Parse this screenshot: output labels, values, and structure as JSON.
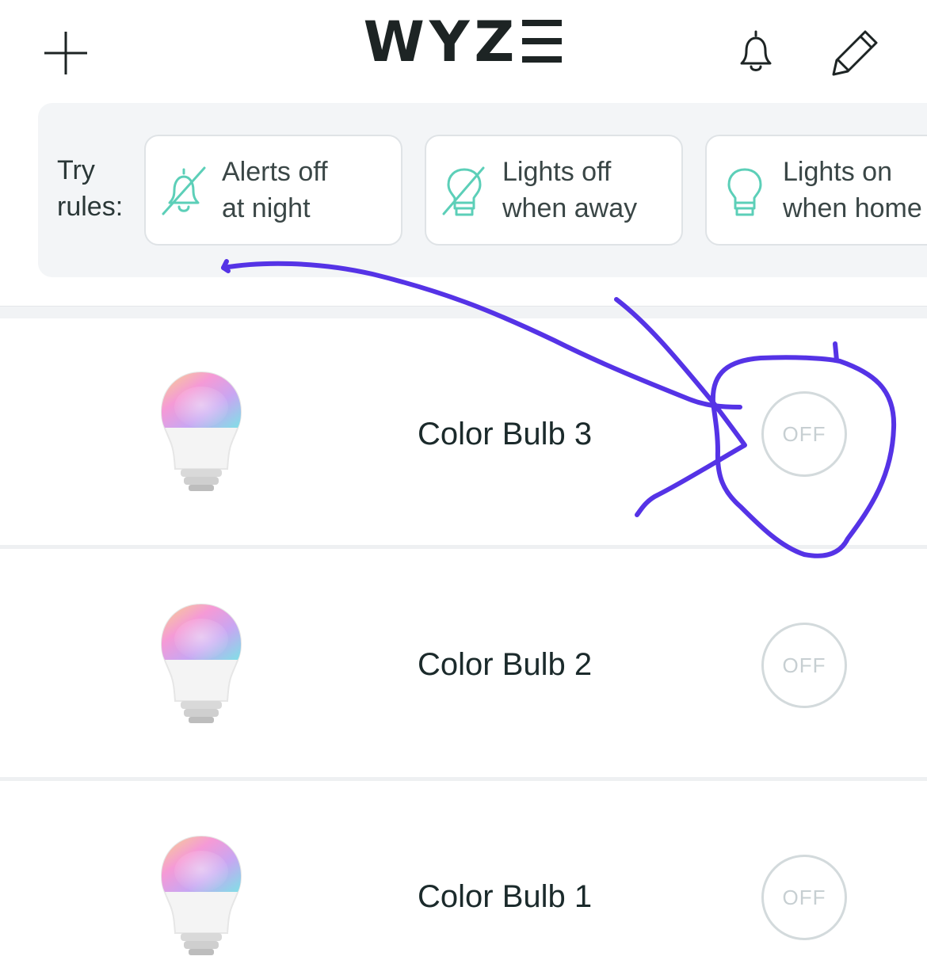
{
  "header": {
    "logo_text": "WYZ",
    "icons": [
      "plus-icon",
      "bell-icon",
      "pencil-icon"
    ]
  },
  "rules": {
    "label": "Try rules:",
    "cards": [
      {
        "line1": "Alerts off",
        "line2": "at night",
        "icon": "bell-off-icon"
      },
      {
        "line1": "Lights off",
        "line2": "when away",
        "icon": "bulb-off-icon"
      },
      {
        "line1": "Lights on",
        "line2": "when home",
        "icon": "bulb-icon"
      }
    ]
  },
  "devices": [
    {
      "name": "Color Bulb 3",
      "state": "OFF"
    },
    {
      "name": "Color Bulb 2",
      "state": "OFF"
    },
    {
      "name": "Color Bulb 1",
      "state": "OFF"
    }
  ],
  "colors": {
    "accent": "#5ccfb8",
    "annotation": "#5533e6",
    "off_ring": "#d3dadc"
  }
}
